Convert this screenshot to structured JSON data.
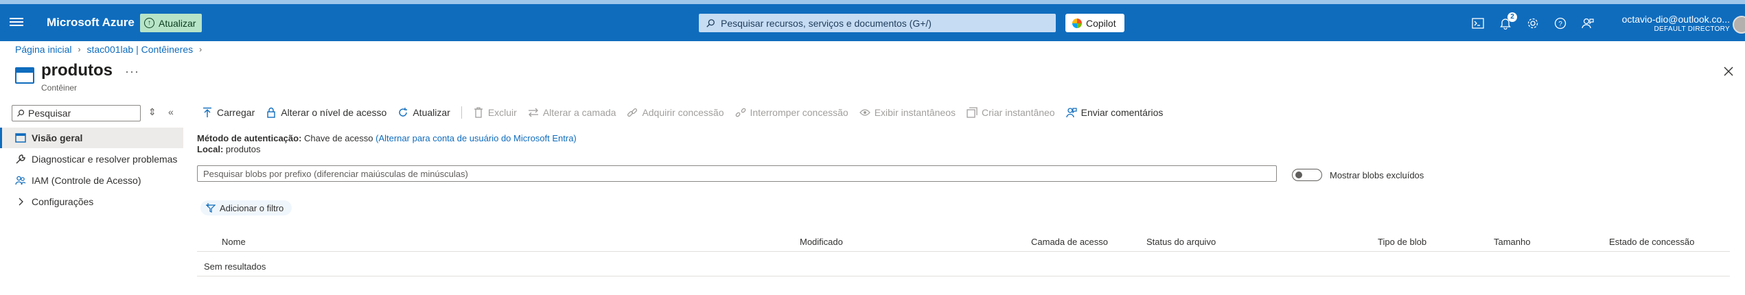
{
  "header": {
    "brand": "Microsoft Azure",
    "update_label": "Atualizar",
    "search_placeholder": "Pesquisar recursos, serviços e documentos (G+/)",
    "copilot_label": "Copilot",
    "notifications_count": "2",
    "account_email": "octavio-dio@outlook.co...",
    "account_directory": "DEFAULT DIRECTORY"
  },
  "breadcrumb": [
    {
      "label": "Página inicial"
    },
    {
      "label": "stac001lab | Contêineres"
    }
  ],
  "page": {
    "title": "produtos",
    "subtitle": "Contêiner",
    "ellipsis": "···"
  },
  "sidebar": {
    "search_placeholder": "Pesquisar",
    "items": [
      {
        "label": "Visão geral"
      },
      {
        "label": "Diagnosticar e resolver problemas"
      },
      {
        "label": "IAM (Controle de Acesso)"
      },
      {
        "label": "Configurações"
      }
    ]
  },
  "toolbar": {
    "upload": "Carregar",
    "change_access": "Alterar o nível de acesso",
    "refresh": "Atualizar",
    "delete": "Excluir",
    "change_tier": "Alterar a camada",
    "acquire_lease": "Adquirir concessão",
    "break_lease": "Interromper concessão",
    "view_snapshots": "Exibir instantâneos",
    "create_snapshot": "Criar instantâneo",
    "feedback": "Enviar comentários"
  },
  "info": {
    "auth_label": "Método de autenticação:",
    "auth_value": "Chave de acesso",
    "auth_link": "(Alternar para conta de usuário do Microsoft Entra)",
    "location_label": "Local:",
    "location_value": "produtos"
  },
  "blobs": {
    "search_placeholder": "Pesquisar blobs por prefixo (diferenciar maiúsculas de minúsculas)",
    "show_deleted_label": "Mostrar blobs excluídos",
    "add_filter_label": "Adicionar o filtro",
    "columns": [
      "Nome",
      "Modificado",
      "Camada de acesso",
      "Status do arquivo",
      "Tipo de blob",
      "Tamanho",
      "Estado de concessão"
    ],
    "empty_text": "Sem resultados"
  },
  "colors": {
    "header_bg": "#0f6cbd",
    "accent": "#0f6cbd",
    "update_bg": "#b7e4c7"
  }
}
